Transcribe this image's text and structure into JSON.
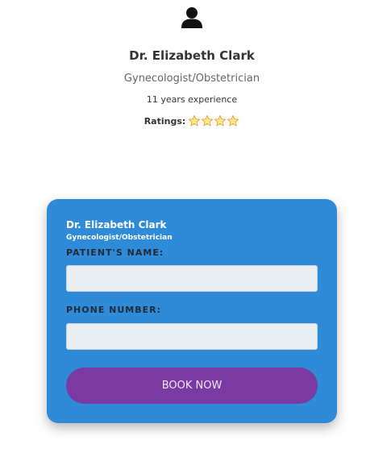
{
  "profile": {
    "avatar_icon": "user-icon",
    "name": "Dr. Elizabeth Clark",
    "specialty": "Gynecologist/Obstetrician",
    "experience": "11 years experience",
    "ratings_label": "Ratings:",
    "rating_stars_shown": 4,
    "star_color": "#f6c343"
  },
  "booking_form": {
    "doctor_name": "Dr. Elizabeth Clark",
    "doctor_specialty": "Gynecologist/Obstetrician",
    "patient_name_label": "PATIENT'S NAME:",
    "patient_name_value": "",
    "phone_label": "PHONE NUMBER:",
    "phone_value": "",
    "submit_label": "BOOK NOW"
  },
  "colors": {
    "card_background": "#2f8ad8",
    "button_background": "#7b3aa3",
    "input_background": "#e8eef2"
  }
}
